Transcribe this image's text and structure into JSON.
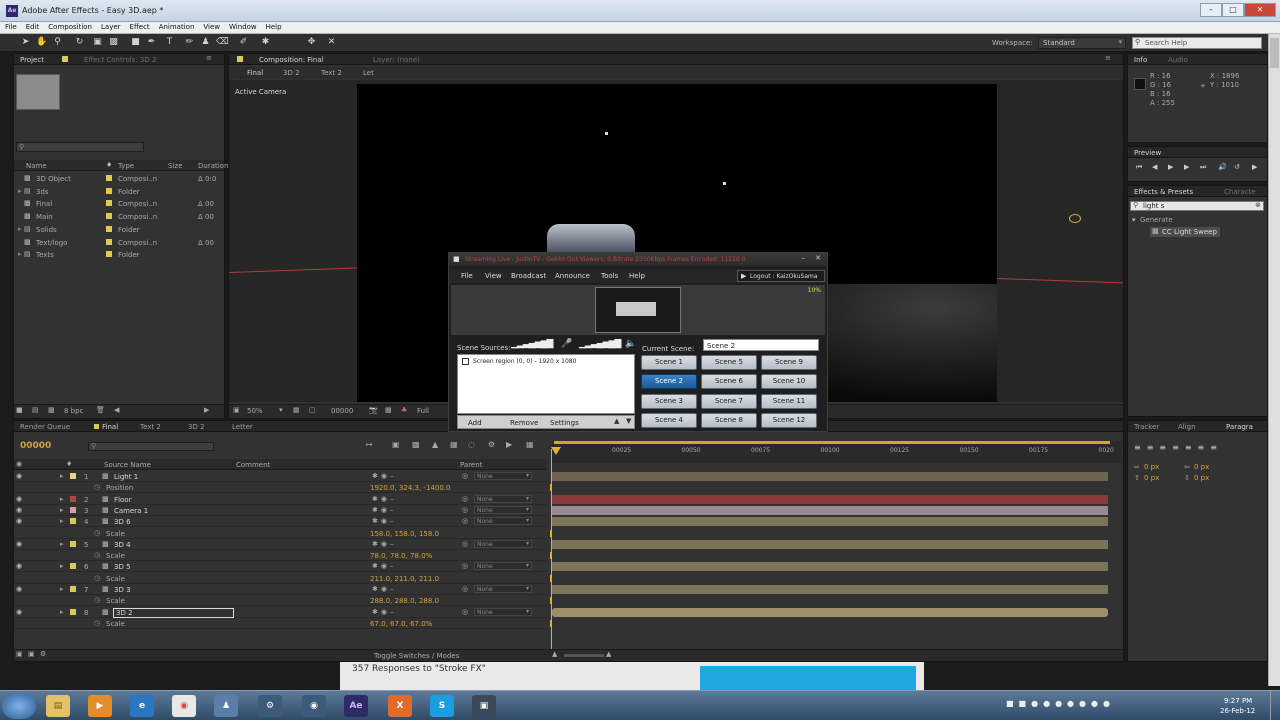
{
  "window": {
    "title": "Adobe After Effects - Easy 3D.aep *",
    "logo": "Ae"
  },
  "menu": [
    "File",
    "Edit",
    "Composition",
    "Layer",
    "Effect",
    "Animation",
    "View",
    "Window",
    "Help"
  ],
  "workspace": {
    "label": "Workspace:",
    "value": "Standard"
  },
  "search_help": {
    "placeholder": "Search Help"
  },
  "project_panel": {
    "tabs": [
      "Project",
      "Effect Controls: 3D 2"
    ],
    "bpc": "8 bpc",
    "columns": [
      "Name",
      "Type",
      "Size",
      "Duration"
    ],
    "items": [
      {
        "name": "3D Object",
        "type": "Composi..n",
        "duration": "Δ 0:0",
        "color": "#d9c85a"
      },
      {
        "name": "3ds",
        "type": "Folder",
        "duration": "",
        "color": "#e0c84a"
      },
      {
        "name": "Final",
        "type": "Composi..n",
        "duration": "Δ 00",
        "color": "#d9c85a"
      },
      {
        "name": "Main",
        "type": "Composi..n",
        "duration": "Δ 00",
        "color": "#d9c85a"
      },
      {
        "name": "Solids",
        "type": "Folder",
        "duration": "",
        "color": "#e0c84a"
      },
      {
        "name": "Text/logo",
        "type": "Composi..n",
        "duration": "Δ 00",
        "color": "#d9c85a"
      },
      {
        "name": "Texts",
        "type": "Folder",
        "duration": "",
        "color": "#e0c84a"
      }
    ]
  },
  "comp_panel": {
    "tabs": [
      "Composition: Final",
      "Layer: (none)"
    ],
    "breadcrumbs": [
      "Final",
      "3D 2",
      "Text 2",
      "Let"
    ],
    "view_label": "Active Camera",
    "zoom": "50%",
    "timecode": "00000",
    "resolution": "Full"
  },
  "info_panel": {
    "tabs": [
      "Info",
      "Audio"
    ],
    "r": "R : 16",
    "g": "G : 16",
    "b": "B : 16",
    "a": "A : 255",
    "x": "X : 1896",
    "y": "Y : 1010"
  },
  "preview_panel": {
    "title": "Preview"
  },
  "effects_panel": {
    "tabs": [
      "Effects & Presets",
      "Characte"
    ],
    "search": "light s",
    "group": "Generate",
    "effect": "CC Light Sweep"
  },
  "timeline": {
    "tabs": [
      "Render Queue",
      "Final",
      "Text 2",
      "3D 2",
      "Letter"
    ],
    "timecode": "00000",
    "ruler": [
      "00025",
      "00050",
      "00075",
      "00100",
      "00125",
      "00150",
      "00175",
      "0020"
    ],
    "col_source": "Source Name",
    "col_comment": "Comment",
    "col_parent": "Parent",
    "toggle": "Toggle Switches / Modes",
    "layers": [
      {
        "num": "1",
        "name": "Light 1",
        "color": "#e6d48a",
        "parent": "None",
        "prop": "Position",
        "val": "1920.0, 324.3, -1400.0",
        "bar": "#6e6250"
      },
      {
        "num": "2",
        "name": "Floor",
        "color": "#b04545",
        "parent": "None",
        "prop": "",
        "val": "",
        "bar": "#8a3a3a"
      },
      {
        "num": "3",
        "name": "Camera 1",
        "color": "#d0a0a8",
        "parent": "None",
        "prop": "",
        "val": "",
        "bar": "#9a8a90"
      },
      {
        "num": "4",
        "name": "3D 6",
        "color": "#d9c85a",
        "parent": "None",
        "prop": "Scale",
        "val": "158.0, 158.0, 158.0",
        "bar": "#7d7358"
      },
      {
        "num": "5",
        "name": "3D 4",
        "color": "#d9c85a",
        "parent": "None",
        "prop": "Scale",
        "val": "78.0, 78.0, 78.0%",
        "bar": "#7d7358"
      },
      {
        "num": "6",
        "name": "3D 5",
        "color": "#d9c85a",
        "parent": "None",
        "prop": "Scale",
        "val": "211.0, 211.0, 211.0",
        "bar": "#7d7358"
      },
      {
        "num": "7",
        "name": "3D 3",
        "color": "#d9c85a",
        "parent": "None",
        "prop": "Scale",
        "val": "288.0, 288.0, 288.0",
        "bar": "#7d7358"
      },
      {
        "num": "8",
        "name": "3D 2",
        "color": "#d9c85a",
        "parent": "None",
        "prop": "Scale",
        "val": "67.0, 67.0, 67.0%",
        "bar": "#9c8f6a"
      }
    ]
  },
  "right_lower_tabs": [
    "Tracker",
    "Align",
    "Paragra"
  ],
  "paragraph": {
    "indent1": "0 px",
    "indent2": "0 px",
    "indent3": "0 px",
    "indent4": "0 px"
  },
  "xsplit": {
    "title": "Streaming Live - JustinTV - Gekko Out  Viewers: 0  Bitrate 2350Kbps  Frames Encoded: 11220 0",
    "menu": [
      "File",
      "View",
      "Broadcast",
      "Announce",
      "Tools",
      "Help"
    ],
    "logout": "Logout : KaizOkuSama",
    "cpu": "10%",
    "scene_sources_label": "Scene Sources:",
    "source_item": "Screen region (0, 0) - 1920 x 1080",
    "current_scene_label": "Current Scene:",
    "current_scene": "Scene 2",
    "scenes": [
      "Scene 1",
      "Scene 5",
      "Scene 9",
      "Scene 2",
      "Scene 6",
      "Scene 10",
      "Scene 3",
      "Scene 7",
      "Scene 11",
      "Scene 4",
      "Scene 8",
      "Scene 12"
    ],
    "active_scene": "Scene 2",
    "buttons": [
      "Add",
      "Remove",
      "Settings"
    ]
  },
  "browser_strip": {
    "text": "357 Responses to \"Stroke FX\""
  },
  "taskbar": {
    "time": "9:27 PM",
    "date": "26-Feb-12"
  }
}
